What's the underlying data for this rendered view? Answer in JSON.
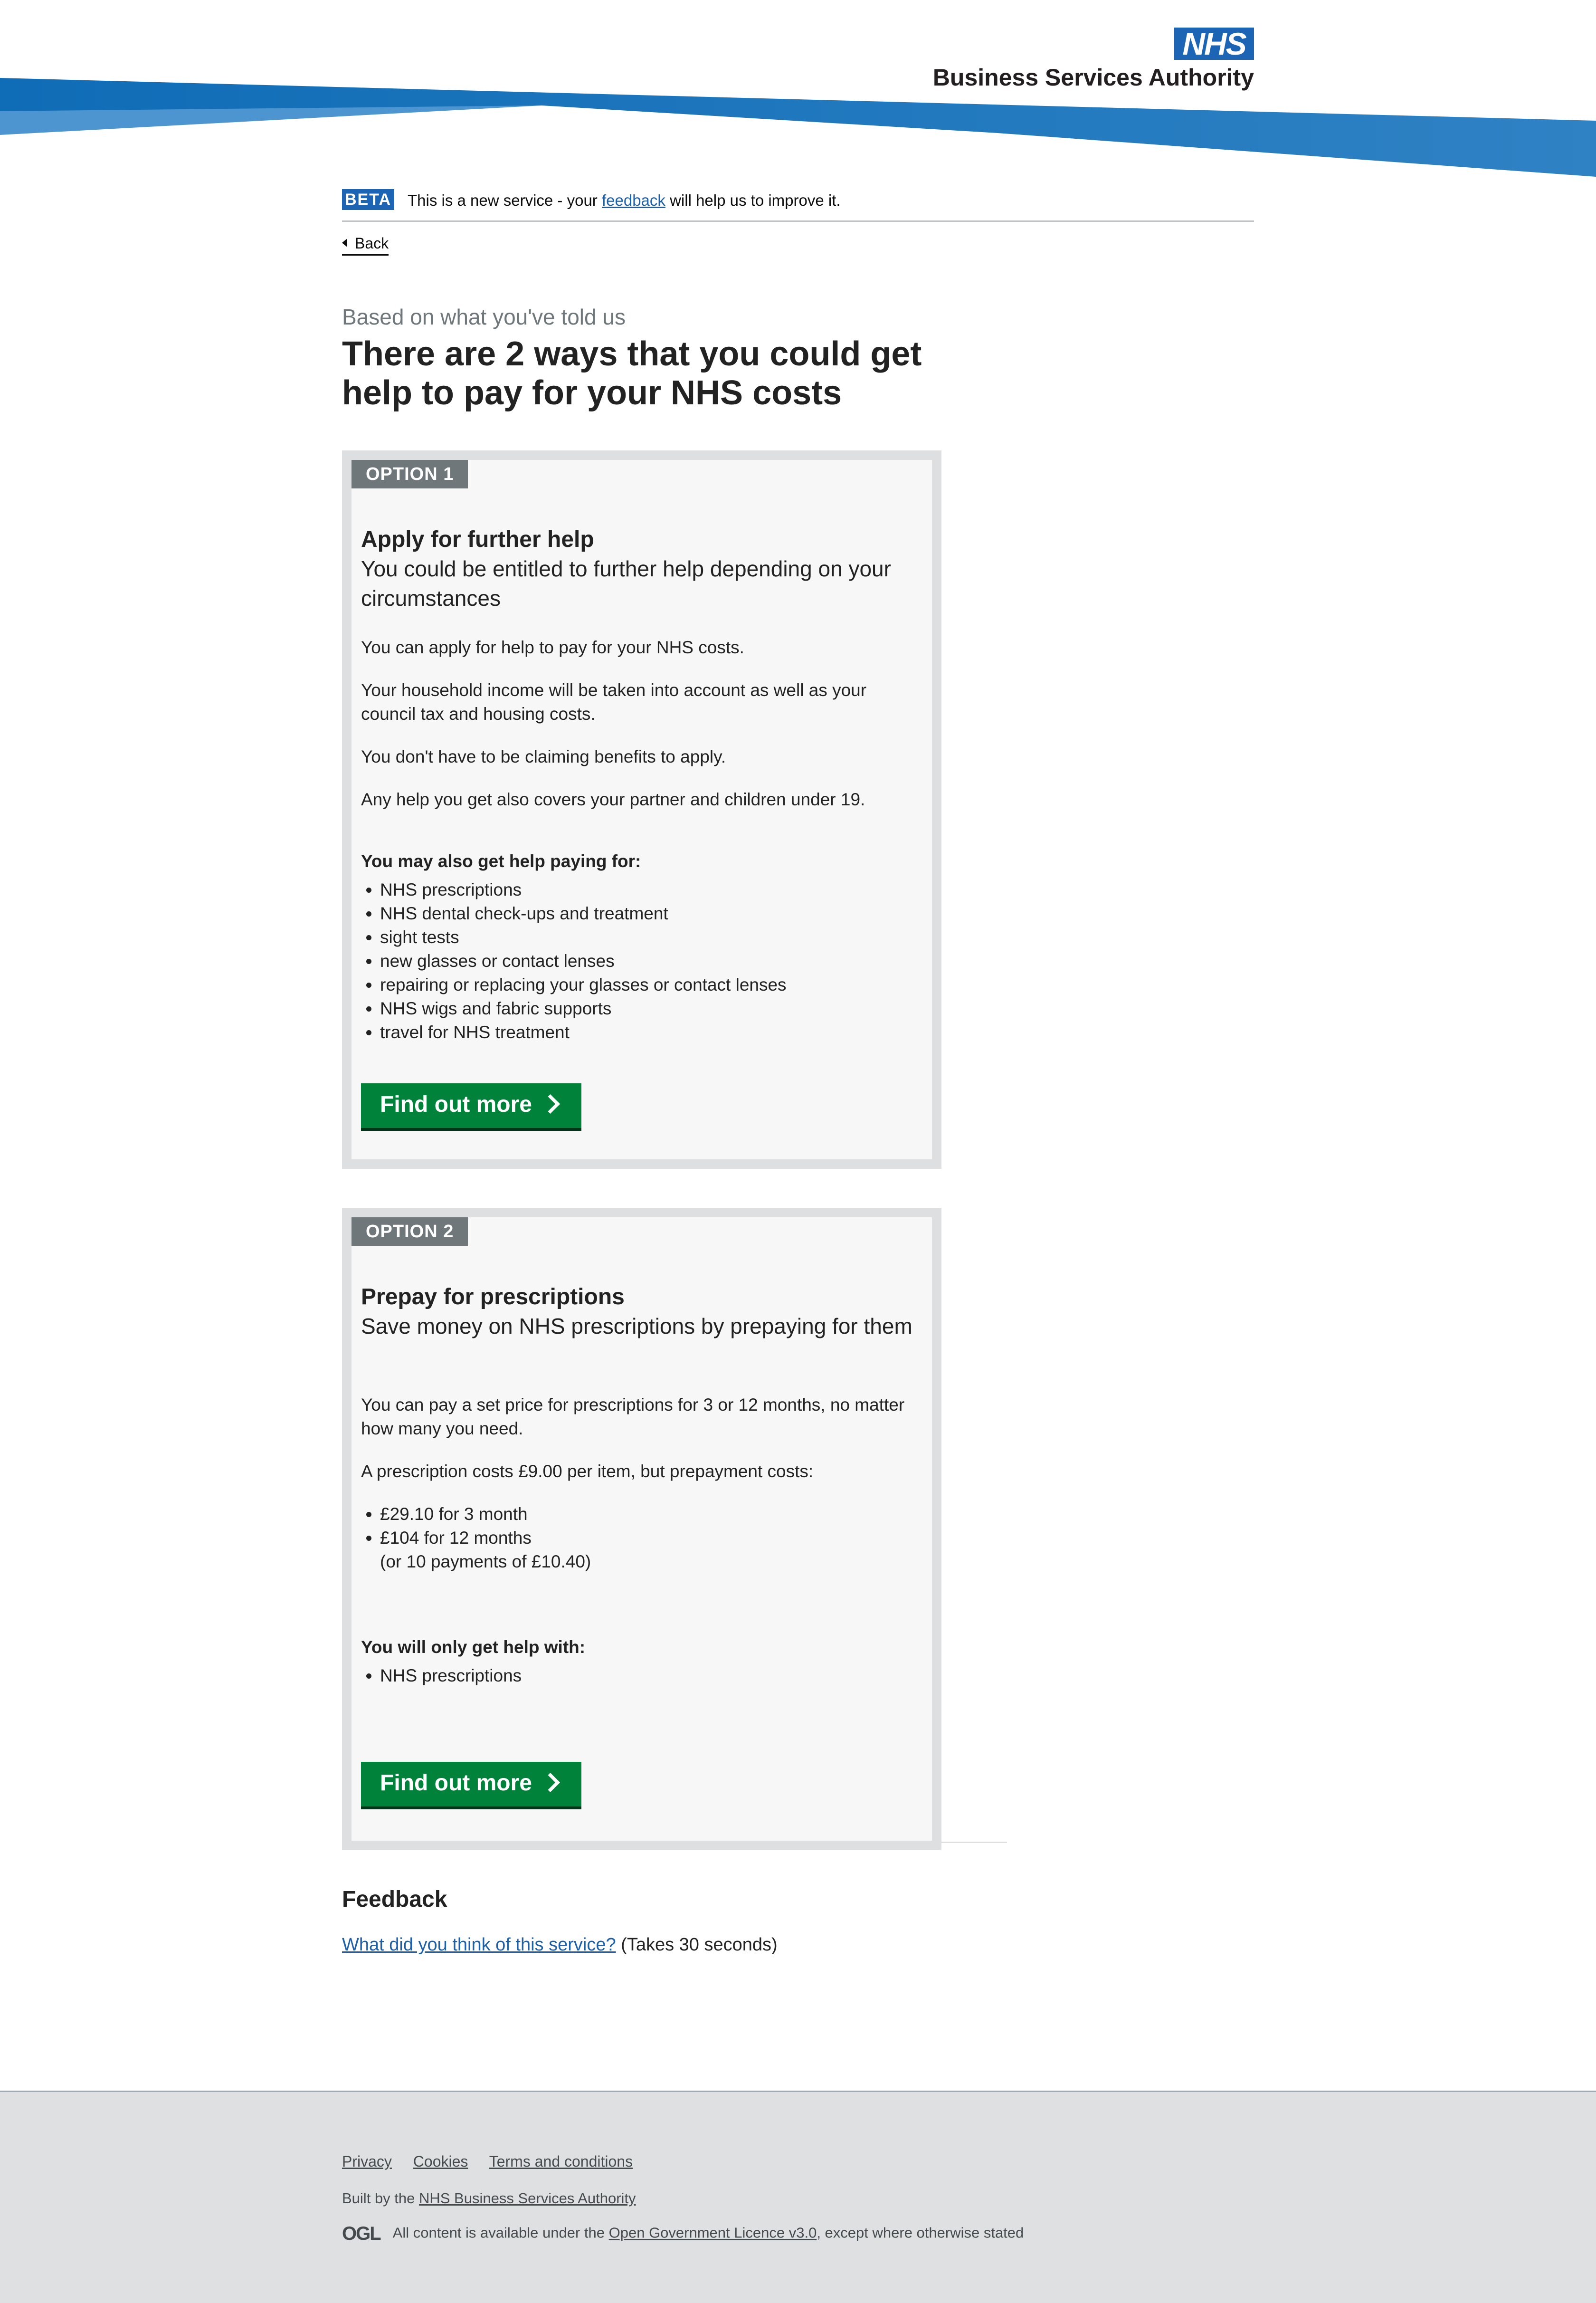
{
  "header": {
    "logo_text": "NHS",
    "org_name": "Business Services Authority"
  },
  "beta": {
    "tag": "BETA",
    "text_before": "This is a new service - your ",
    "link": "feedback",
    "text_after": " will help us to improve it."
  },
  "back": {
    "label": "Back"
  },
  "page": {
    "caption": "Based on what you've told us",
    "title": "There are 2 ways that you could get help to pay for your NHS costs"
  },
  "option1": {
    "tag": "OPTION 1",
    "heading": "Apply for further help",
    "subheading": "You could be entitled to further help depending on your circumstances",
    "paragraphs": [
      "You can apply for help to pay for your NHS costs.",
      "Your household income will be taken into account as well as your council tax and housing costs.",
      "You don't have to be claiming benefits to apply.",
      "Any help you get also covers your partner and children under 19."
    ],
    "list_title": "You may also get help paying for:",
    "list": [
      "NHS prescriptions",
      "NHS dental check-ups and treatment",
      "sight tests",
      "new glasses or contact lenses",
      "repairing or replacing your glasses or contact lenses",
      "NHS wigs and fabric supports",
      "travel for NHS treatment"
    ],
    "button": "Find out more"
  },
  "option2": {
    "tag": "OPTION 2",
    "heading": "Prepay for prescriptions",
    "subheading": "Save money on NHS prescriptions by prepaying for them",
    "paragraphs": [
      "You can pay a set price for prescriptions for 3 or 12 months, no matter how many you need.",
      "A prescription costs £9.00 per item, but prepayment costs:"
    ],
    "prices": [
      "£29.10 for 3 month",
      "£104 for 12 months"
    ],
    "price_note": "(or 10 payments of £10.40)",
    "list_title": "You will only get help with:",
    "list": [
      "NHS prescriptions"
    ],
    "button": "Find out more"
  },
  "feedback": {
    "title": "Feedback",
    "link": "What did you think of this service?",
    "note": " (Takes 30 seconds)"
  },
  "footer": {
    "links": [
      "Privacy",
      "Cookies",
      "Terms and conditions"
    ],
    "built_by_prefix": "Built by the ",
    "built_by_link": "NHS Business Services Authority",
    "ogl_logo": "OGL",
    "licence_prefix": "All content is available under the ",
    "licence_link": "Open Government Licence v3.0",
    "licence_suffix": ", except where otherwise stated"
  },
  "colors": {
    "nhs_blue": "#1b65b4",
    "button_green": "#00823b",
    "tag_grey": "#6f777b",
    "card_bg": "#f7f7f7",
    "card_border": "#dedfe0",
    "link_blue": "#1d5fa8",
    "footer_bg": "#dee0e2"
  }
}
